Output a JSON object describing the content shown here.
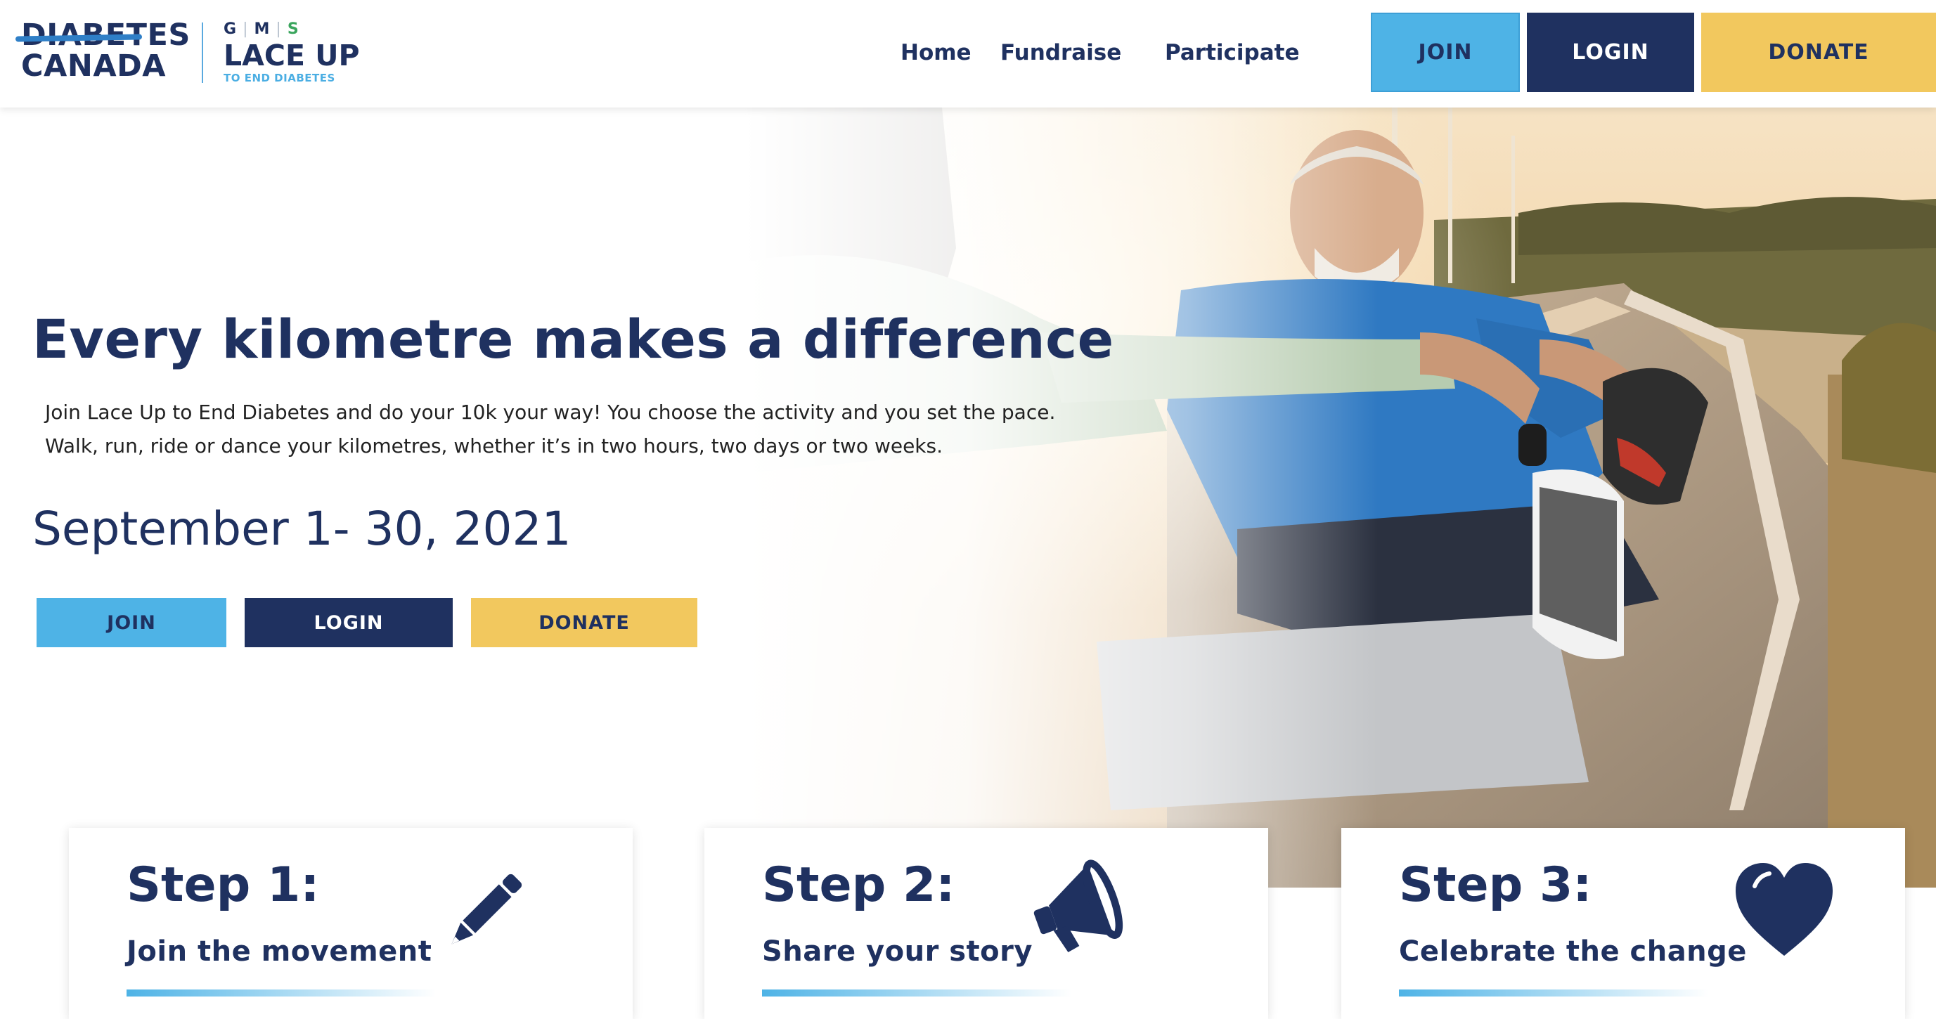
{
  "header": {
    "logo_diabetes_line1": "DIABETES",
    "logo_diabetes_line2": "CANADA",
    "logo_gms_g": "G",
    "logo_gms_m": "M",
    "logo_gms_s": "S",
    "logo_lace_up": "LACE UP",
    "logo_tagline": "TO END DIABETES",
    "nav": {
      "home": "Home",
      "fundraise": "Fundraise",
      "participate": "Participate"
    },
    "buttons": {
      "join": "JOIN",
      "login": "LOGIN",
      "donate": "DONATE"
    }
  },
  "hero": {
    "title": "Every kilometre makes a difference",
    "description_line1": "Join Lace Up to End Diabetes and do your 10k your way! You choose the activity and you set the pace.",
    "description_line2": "Walk, run, ride or dance your kilometres, whether it’s in two hours, two days or two weeks.",
    "dates": "September 1- 30, 2021",
    "buttons": {
      "join": "JOIN",
      "login": "LOGIN",
      "donate": "DONATE"
    }
  },
  "steps": [
    {
      "title": "Step 1:",
      "subtitle": "Join the movement",
      "icon": "pencil-icon"
    },
    {
      "title": "Step 2:",
      "subtitle": "Share your story",
      "icon": "megaphone-icon"
    },
    {
      "title": "Step 3:",
      "subtitle": "Celebrate the change",
      "icon": "heart-icon"
    }
  ],
  "colors": {
    "navy": "#1f3160",
    "light_blue": "#4eb3e6",
    "yellow": "#f2c85e",
    "white": "#ffffff"
  }
}
